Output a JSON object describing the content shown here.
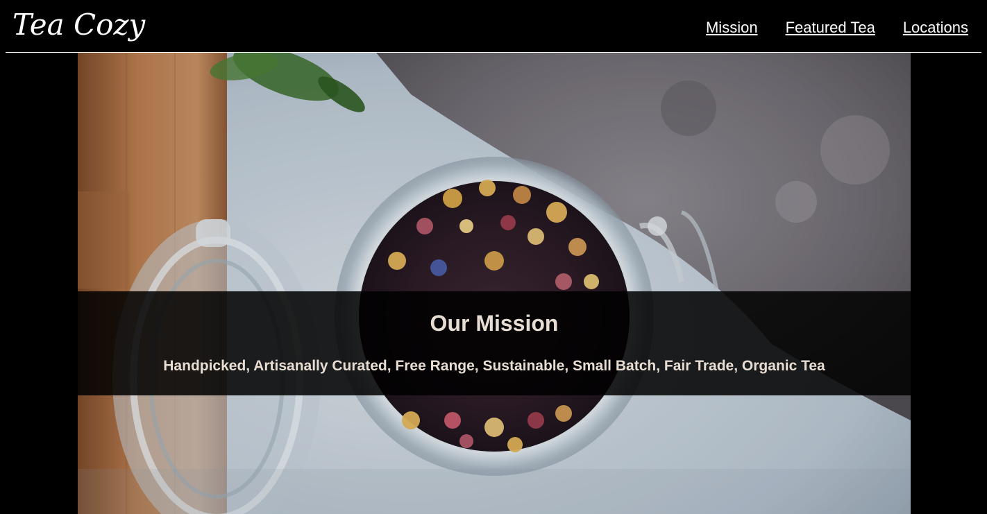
{
  "header": {
    "logo": "Tea Cozy",
    "nav": [
      {
        "label": "Mission"
      },
      {
        "label": "Featured Tea"
      },
      {
        "label": "Locations"
      }
    ]
  },
  "hero": {
    "image_description_icon": "tea-jar-image",
    "mission_title": "Our Mission",
    "mission_text": "Handpicked, Artisanally Curated, Free Range, Sustainable, Small Batch, Fair Trade, Organic Tea"
  },
  "colors": {
    "background": "#000000",
    "header_text": "#ffffff",
    "mission_text": "#e8ddd2",
    "band_overlay": "rgba(0,0,0,0.86)"
  }
}
